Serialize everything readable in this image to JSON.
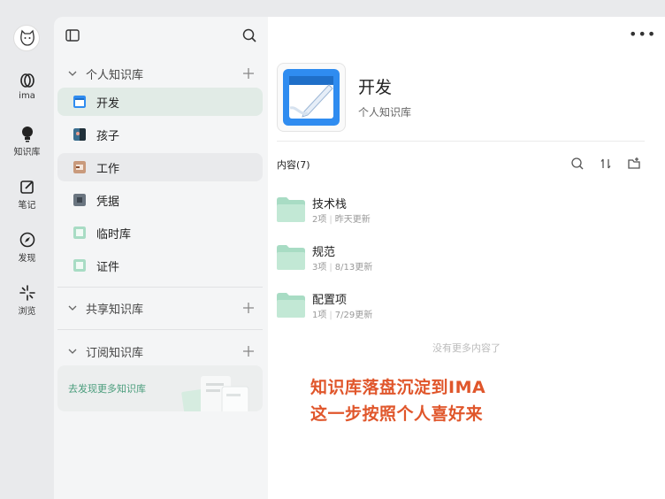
{
  "rail": {
    "items": [
      {
        "label": "ima"
      },
      {
        "label": "知识库"
      },
      {
        "label": "笔记"
      },
      {
        "label": "发现"
      },
      {
        "label": "浏览"
      }
    ]
  },
  "sidebar": {
    "personal": {
      "title": "个人知识库",
      "items": [
        {
          "name": "开发",
          "color": "#2f8cf0"
        },
        {
          "name": "孩子",
          "color": "#3a6e8f"
        },
        {
          "name": "工作",
          "color": "#b47a5a"
        },
        {
          "name": "凭据",
          "color": "#6a7580"
        },
        {
          "name": "临时库",
          "color": "#8fd0b0"
        },
        {
          "name": "证件",
          "color": "#8fd0b0"
        }
      ]
    },
    "shared": {
      "title": "共享知识库"
    },
    "subscribed": {
      "title": "订阅知识库"
    },
    "discover_text": "去发现更多知识库"
  },
  "main": {
    "kb_title": "开发",
    "kb_subtitle": "个人知识库",
    "content_header": "内容(7)",
    "folders": [
      {
        "name": "技术栈",
        "count": "2项",
        "updated": "昨天更新"
      },
      {
        "name": "规范",
        "count": "3项",
        "updated": "8/13更新"
      },
      {
        "name": "配置项",
        "count": "1项",
        "updated": "7/29更新"
      }
    ],
    "no_more": "没有更多内容了",
    "annotation_line1": "知识库落盘沉淀到IMA",
    "annotation_line2": "这一步按照个人喜好来"
  },
  "colors": {
    "accent_green": "#4a9d7c",
    "annotation": "#e0562b",
    "folder": "#a8dcc4"
  }
}
